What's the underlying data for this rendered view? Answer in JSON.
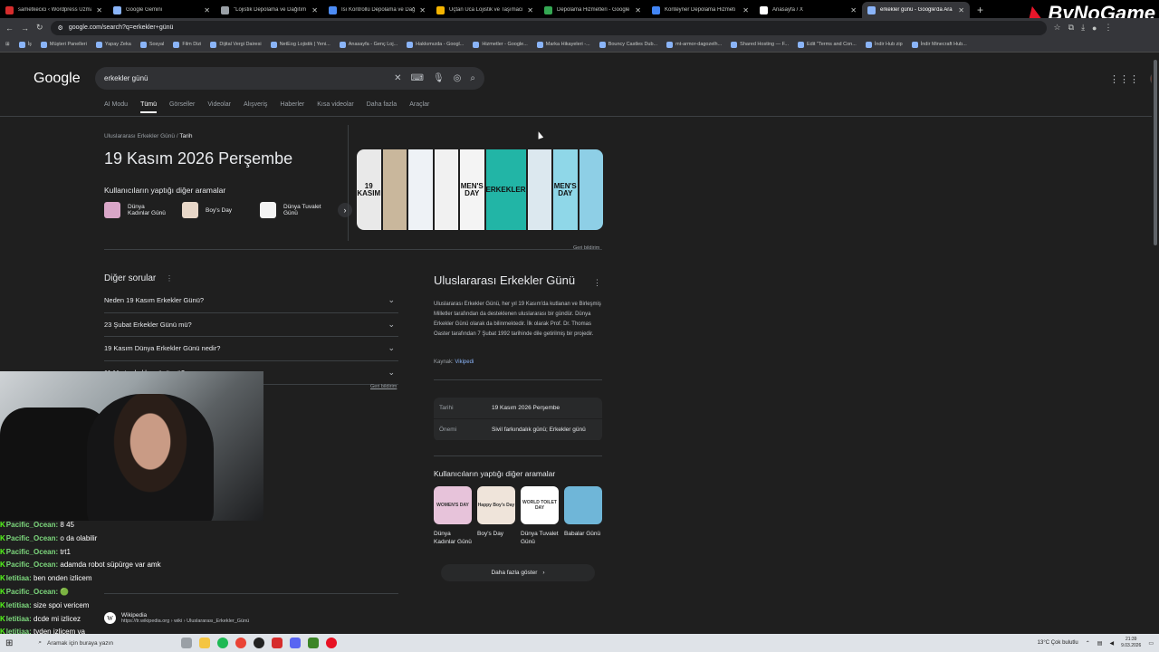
{
  "browser": {
    "tabs": [
      {
        "title": "sametkecici ‹ Wordpress Uzmanı",
        "color": "#d62c2c"
      },
      {
        "title": "Google Gemini",
        "color": "#8ab4f8"
      },
      {
        "title": "\"Lojistik Depolama ve Dağıtım",
        "color": "#9aa0a6"
      },
      {
        "title": "Isı Kontrollü Depolama ve Dağı",
        "color": "#4c8bf5"
      },
      {
        "title": "Uçtan Uca Lojistik ve Taşımacılık",
        "color": "#f4b400"
      },
      {
        "title": "Depolama Hizmetleri - Google",
        "color": "#34a853"
      },
      {
        "title": "Konteyner Depolama Hizmeti",
        "color": "#4285f4"
      },
      {
        "title": "Anasayfa / X",
        "color": "#ffffff"
      },
      {
        "title": "erkekler günü - Google'da Ara",
        "color": "#8ab4f8"
      }
    ],
    "new_tab": "+",
    "url": "google.com/search?q=erkekler+günü",
    "bookmarks": [
      "İş",
      "Müşteri Panelleri",
      "Yapay Zeka",
      "Sosyal",
      "Film Dizi",
      "Dijital Vergi Dairesi",
      "NetEog Lojistik | Yeni...",
      "Anasayfa - Genç Loj...",
      "Hakkımızda - Googl...",
      "Hizmetler - Google...",
      "Marka Hikayeleri -...",
      "Bouncy Castles Dub...",
      "mt-armor-dagozelh...",
      "Shared Hosting — F...",
      "Edit \"Terms and Con...",
      "İndir Hub zip",
      "İndir Minecraft Hub..."
    ],
    "watermark": "ByNoGame"
  },
  "google": {
    "logo": "Google",
    "query": "erkekler günü",
    "nav_tabs": [
      "AI Modu",
      "Tümü",
      "Görseller",
      "Videolar",
      "Alışveriş",
      "Haberler",
      "Kısa videolar",
      "Daha fazla",
      "Araçlar"
    ],
    "breadcrumb": {
      "parent": "Uluslararası Erkekler Günü",
      "sep": "/",
      "current": "Tarih"
    },
    "answer": "19 Kasım 2026 Perşembe",
    "related_top_title": "Kullanıcıların yaptığı diğer aramalar",
    "related_top": [
      {
        "label": "Dünya Kadınlar Günü",
        "color": "#d9a6c8"
      },
      {
        "label": "Boy's Day",
        "color": "#e8d7c8"
      },
      {
        "label": "Dünya Tuvalet Günü",
        "color": "#f3f3f3"
      }
    ],
    "image_strip": [
      {
        "text": "19 KASIM",
        "color": "#e9e9e9"
      },
      {
        "text": "",
        "color": "#c9b79c"
      },
      {
        "text": "",
        "color": "#eef2f6"
      },
      {
        "text": "",
        "color": "#f1f1f1"
      },
      {
        "text": "MEN'S DAY",
        "color": "#f4f4f4"
      },
      {
        "text": "ERKEKLER",
        "color": "#22b5a6"
      },
      {
        "text": "",
        "color": "#dce8ef"
      },
      {
        "text": "MEN'S DAY",
        "color": "#8fd7e8"
      },
      {
        "text": "",
        "color": "#8ecfe6"
      }
    ],
    "feedback": "Geri bildirim",
    "paa_title": "Diğer sorular",
    "paa": [
      "Neden 19 Kasım Erkekler Günü?",
      "23 Şubat Erkekler Günü mü?",
      "19 Kasım Dünya Erkekler Günü nedir?",
      "11 Mart erkekler günü mü?"
    ],
    "kp": {
      "title": "Uluslararası Erkekler Günü",
      "description": "Uluslararası Erkekler Günü, her yıl 19 Kasım'da kutlanan ve Birleşmiş Milletler tarafından da desteklenen uluslararası bir gündür. Dünya Erkekler Günü olarak da bilinmektedir. İlk olarak Prof. Dr. Thomas Oaster tarafından 7 Şubat 1992 tarihinde dile getirilmiş bir projedir.",
      "source_label": "Kaynak:",
      "source_link": "Vikipedi",
      "facts": [
        {
          "k": "Tarihi",
          "v": "19 Kasım 2026 Perşembe"
        },
        {
          "k": "Önemi",
          "v": "Sivil farkındalık günü; Erkekler günü"
        }
      ],
      "related_title": "Kullanıcıların yaptığı diğer aramalar",
      "related": [
        {
          "label": "Dünya Kadınlar Günü",
          "color": "#e7c3da",
          "thumb_text": "WOMEN'S DAY"
        },
        {
          "label": "Boy's Day",
          "color": "#efe4da",
          "thumb_text": "Happy Boy's Day"
        },
        {
          "label": "Dünya Tuvalet Günü",
          "color": "#ffffff",
          "thumb_text": "WORLD TOILET DAY"
        },
        {
          "label": "Babalar Günü",
          "color": "#6fb6d8",
          "thumb_text": ""
        }
      ],
      "more": "Daha fazla göster"
    },
    "wiki": {
      "name": "Wikipedia",
      "url": "https://tr.wikipedia.org › wiki › Uluslararası_Erkekler_Günü"
    }
  },
  "chat": [
    {
      "user": "Pacific_Ocean:",
      "text": "8 45"
    },
    {
      "user": "Pacific_Ocean:",
      "text": "o da olabilir"
    },
    {
      "user": "Pacific_Ocean:",
      "text": "trt1"
    },
    {
      "user": "Pacific_Ocean:",
      "text": "adamda robot süpürge var amk"
    },
    {
      "user": "letitiaa:",
      "text": "ben onden izlicem"
    },
    {
      "user": "Pacific_Ocean:",
      "text": "🟢"
    },
    {
      "user": "letitiaa:",
      "text": "size spoi vericem"
    },
    {
      "user": "letitiaa:",
      "text": "dcde mi izlicez"
    },
    {
      "user": "letitiaa:",
      "text": "tyden izlicem va"
    }
  ],
  "taskbar": {
    "search": "Aramak için buraya yazın",
    "weather": "13°C Çok bulutlu",
    "time": "21:39",
    "date": "9.03.2026"
  }
}
